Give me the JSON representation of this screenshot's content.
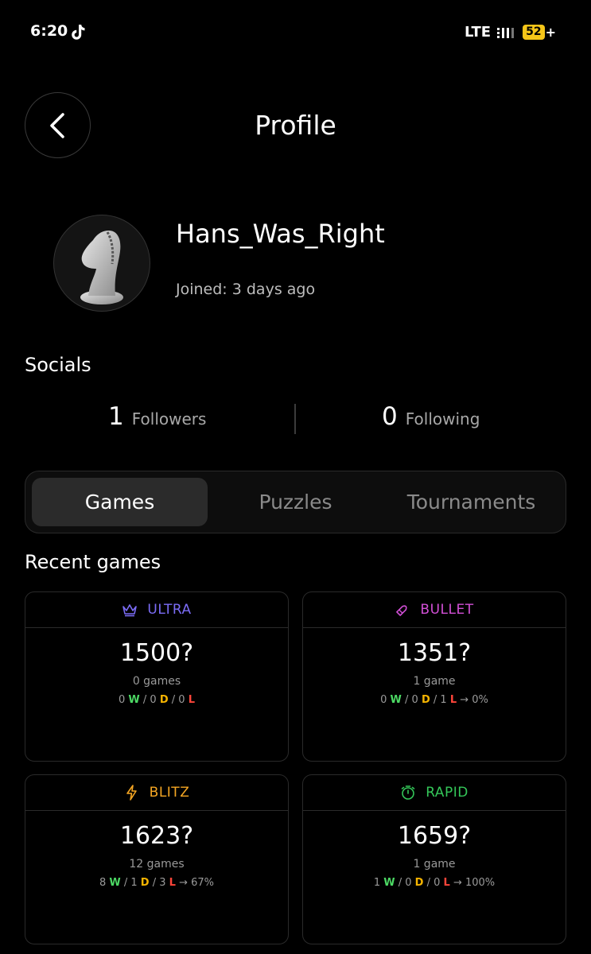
{
  "status": {
    "time": "6:20",
    "network": "LTE",
    "battery": "52",
    "battery_suffix": "+"
  },
  "header": {
    "title": "Profile"
  },
  "profile": {
    "username": "Hans_Was_Right",
    "joined": "Joined: 3 days ago"
  },
  "socials": {
    "title": "Socials",
    "followers_count": "1",
    "followers_label": "Followers",
    "following_count": "0",
    "following_label": "Following"
  },
  "tabs": [
    {
      "label": "Games",
      "active": true
    },
    {
      "label": "Puzzles",
      "active": false
    },
    {
      "label": "Tournaments",
      "active": false
    }
  ],
  "recent": {
    "title": "Recent games",
    "cards": [
      {
        "mode": "ULTRA",
        "color": "#7b6cf6",
        "icon": "crown-icon",
        "rating": "1500?",
        "games": "0 games",
        "w": "0",
        "w_l": "W",
        "d": "0",
        "d_l": "D",
        "l": "0",
        "l_l": "L",
        "pct": ""
      },
      {
        "mode": "BULLET",
        "color": "#d24fd6",
        "icon": "bullet-icon",
        "rating": "1351?",
        "games": "1 game",
        "w": "0",
        "w_l": "W",
        "d": "0",
        "d_l": "D",
        "l": "1",
        "l_l": "L",
        "pct": "→ 0%"
      },
      {
        "mode": "BLITZ",
        "color": "#f5a623",
        "icon": "lightning-icon",
        "rating": "1623?",
        "games": "12 games",
        "w": "8",
        "w_l": "W",
        "d": "1",
        "d_l": "D",
        "l": "3",
        "l_l": "L",
        "pct": "→ 67%"
      },
      {
        "mode": "RAPID",
        "color": "#34c759",
        "icon": "stopwatch-icon",
        "rating": "1659?",
        "games": "1 game",
        "w": "1",
        "w_l": "W",
        "d": "0",
        "d_l": "D",
        "l": "0",
        "l_l": "L",
        "pct": "→ 100%"
      }
    ]
  }
}
